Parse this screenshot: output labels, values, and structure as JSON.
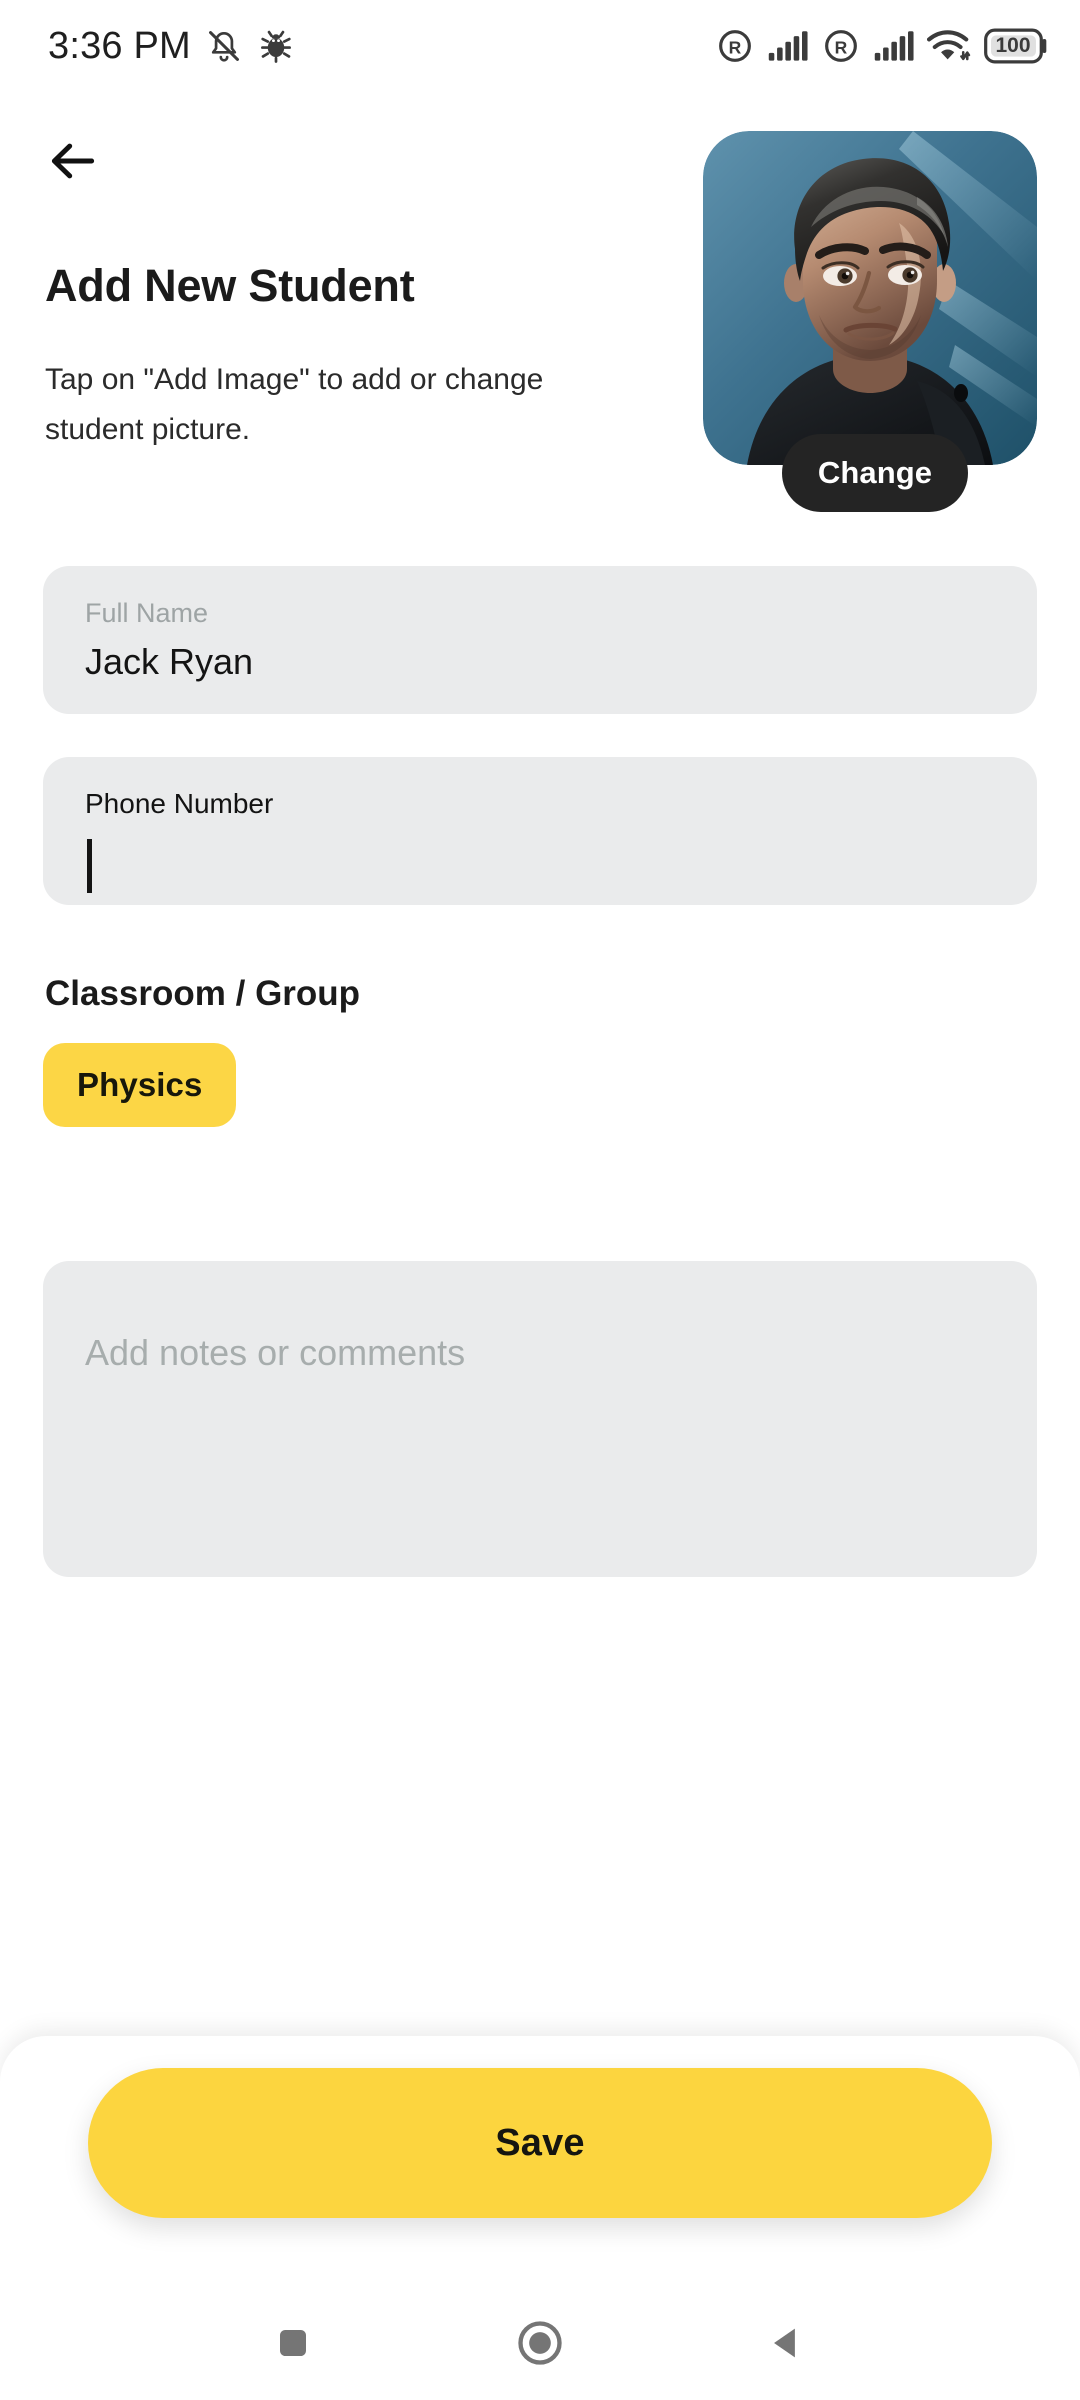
{
  "status_bar": {
    "time": "3:36 PM",
    "left_icons": [
      "bell-off-icon",
      "bug-icon"
    ],
    "right_icons": [
      "roaming-icon",
      "signal-bars-icon",
      "roaming-icon",
      "signal-bars-icon",
      "wifi-icon",
      "battery-icon"
    ],
    "battery_level": "100"
  },
  "header": {
    "back_icon": "back-arrow-icon",
    "title": "Add New Student",
    "subtitle": "Tap on \"Add Image\" to add or change student picture."
  },
  "avatar": {
    "name": "student-photo",
    "change_label": "Change"
  },
  "form": {
    "full_name": {
      "label": "Full Name",
      "value": "Jack Ryan"
    },
    "phone_number": {
      "label": "Phone Number",
      "value": ""
    },
    "classroom": {
      "heading": "Classroom / Group",
      "chips": [
        {
          "label": "Physics",
          "selected": true
        }
      ]
    },
    "notes": {
      "placeholder": "Add notes or comments",
      "value": ""
    }
  },
  "footer": {
    "save_label": "Save"
  },
  "nav_bar": {
    "recents": "recents-square-icon",
    "home": "home-circle-icon",
    "back": "back-triangle-icon"
  },
  "colors": {
    "accent_yellow": "#FCD645",
    "field_gray": "#EAEBEC",
    "dark_pill": "#242424",
    "text_primary": "#1B1B1B",
    "text_muted": "#9EA4A5"
  }
}
